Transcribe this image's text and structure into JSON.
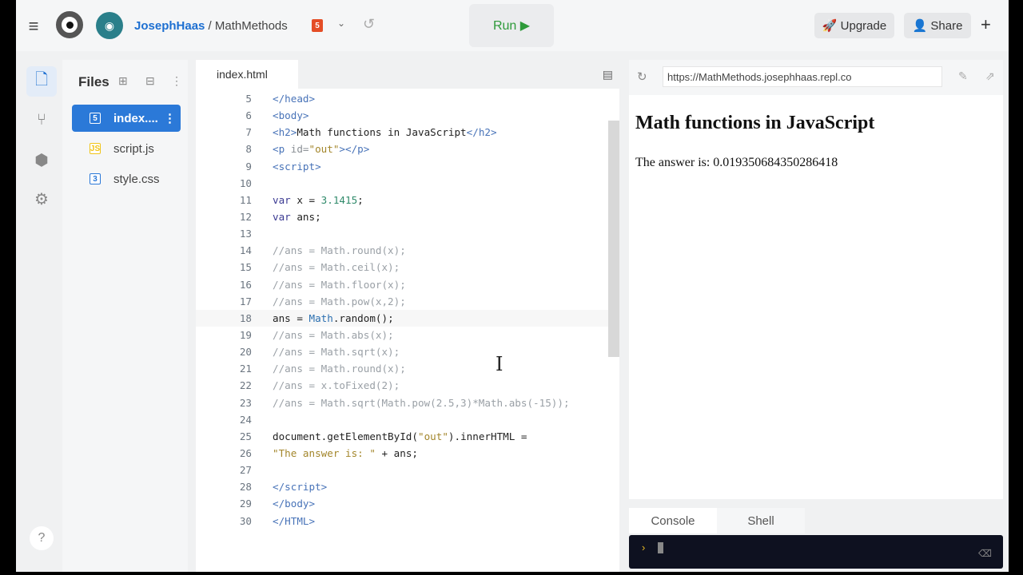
{
  "topbar": {
    "user": "JosephHaas",
    "sep": " / ",
    "repl": "MathMethods",
    "run": "Run ▶",
    "upgrade": "Upgrade",
    "share": "Share",
    "html_badge": "5"
  },
  "files": {
    "title": "Files",
    "items": [
      {
        "name": "index....",
        "badge": "5",
        "color": "#ffffff"
      },
      {
        "name": "script.js",
        "badge": "JS",
        "color": "#f0c419"
      },
      {
        "name": "style.css",
        "badge": "3",
        "color": "#2b79d8"
      }
    ]
  },
  "editor": {
    "tab": "index.html",
    "cursor_line": 18,
    "lines": [
      {
        "n": "5",
        "t": [
          [
            "</",
            "tag"
          ],
          [
            "head",
            "tag"
          ],
          [
            ">",
            "tag"
          ]
        ]
      },
      {
        "n": "6",
        "t": [
          [
            "<body>",
            "tag"
          ]
        ]
      },
      {
        "n": "7",
        "t": [
          [
            "<h2>",
            "tag"
          ],
          [
            "Math functions in JavaScript",
            ""
          ],
          [
            "</h2>",
            "tag"
          ]
        ]
      },
      {
        "n": "8",
        "t": [
          [
            "<p ",
            "tag"
          ],
          [
            "id=",
            "attr"
          ],
          [
            "\"out\"",
            "str"
          ],
          [
            "></p>",
            "tag"
          ]
        ]
      },
      {
        "n": "9",
        "t": [
          [
            "<script>",
            "tag"
          ]
        ]
      },
      {
        "n": "10",
        "t": []
      },
      {
        "n": "11",
        "t": [
          [
            "var",
            "kw"
          ],
          [
            " x = ",
            ""
          ],
          [
            "3.1415",
            "num"
          ],
          [
            ";",
            ""
          ]
        ]
      },
      {
        "n": "12",
        "t": [
          [
            "var",
            "kw"
          ],
          [
            " ans;",
            ""
          ]
        ]
      },
      {
        "n": "13",
        "t": []
      },
      {
        "n": "14",
        "t": [
          [
            "//ans = Math.round(x);",
            "com"
          ]
        ]
      },
      {
        "n": "15",
        "t": [
          [
            "//ans = Math.ceil(x);",
            "com"
          ]
        ]
      },
      {
        "n": "16",
        "t": [
          [
            "//ans = Math.floor(x);",
            "com"
          ]
        ]
      },
      {
        "n": "17",
        "t": [
          [
            "//ans = Math.pow(x,2);",
            "com"
          ]
        ]
      },
      {
        "n": "18",
        "t": [
          [
            "ans = ",
            ""
          ],
          [
            "Math",
            "fn"
          ],
          [
            ".random();",
            ""
          ]
        ]
      },
      {
        "n": "19",
        "t": [
          [
            "//ans = Math.abs(x);",
            "com"
          ]
        ]
      },
      {
        "n": "20",
        "t": [
          [
            "//ans = Math.sqrt(x);",
            "com"
          ]
        ]
      },
      {
        "n": "21",
        "t": [
          [
            "//ans = Math.round(x);",
            "com"
          ]
        ]
      },
      {
        "n": "22",
        "t": [
          [
            "//ans = x.toFixed(2);",
            "com"
          ]
        ]
      },
      {
        "n": "23",
        "t": [
          [
            "//ans = Math.sqrt(Math.pow(2.5,3)*Math.abs(-15));",
            "com"
          ]
        ]
      },
      {
        "n": "24",
        "t": []
      },
      {
        "n": "25",
        "t": [
          [
            "document.getElementById(",
            ""
          ],
          [
            "\"out\"",
            "str"
          ],
          [
            ").innerHTML =",
            ""
          ]
        ]
      },
      {
        "n": "26",
        "t": [
          [
            "\"The answer is: \"",
            "str"
          ],
          [
            " + ans;",
            ""
          ]
        ]
      },
      {
        "n": "27",
        "t": []
      },
      {
        "n": "28",
        "t": [
          [
            "</script>",
            "tag"
          ]
        ]
      },
      {
        "n": "29",
        "t": [
          [
            "</body>",
            "tag"
          ]
        ]
      },
      {
        "n": "30",
        "t": [
          [
            "</HTML>",
            "tag"
          ]
        ]
      }
    ]
  },
  "preview": {
    "url": "https://MathMethods.josephhaas.repl.co",
    "heading": "Math functions in JavaScript",
    "output": "The answer is: 0.019350684350286418"
  },
  "console": {
    "tabs": [
      "Console",
      "Shell"
    ]
  }
}
